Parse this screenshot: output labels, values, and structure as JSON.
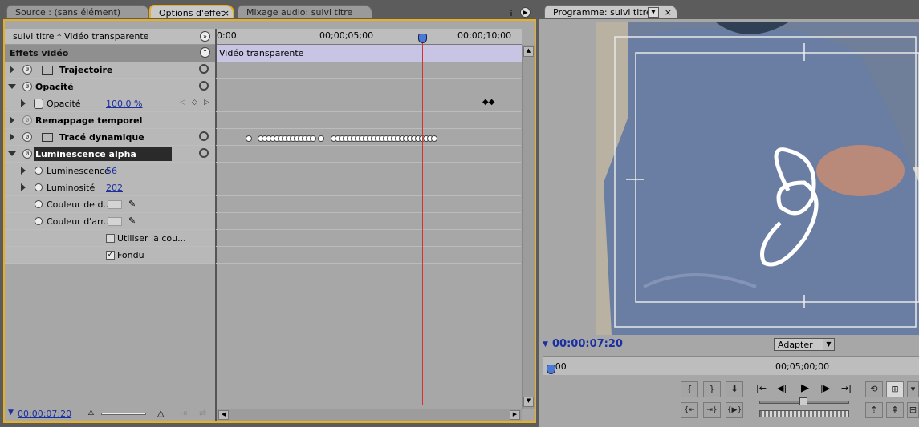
{
  "tabs": {
    "source": "Source : (sans élément)",
    "effect_options": "Options d'effet",
    "audio_mixer": "Mixage audio: suivi titre",
    "program": "Programme: suivi titre"
  },
  "effects_panel": {
    "clip_path": "suivi titre * Vidéo transparente",
    "section_title": "Effets vidéo",
    "clip_bar_label": "Vidéo transparente",
    "ruler": [
      "0:00",
      "00;00;05;00",
      "00;00;10;00"
    ],
    "timecode": "00:00:07:20",
    "rows": {
      "trajectoire": "Trajectoire",
      "opacite": "Opacité",
      "opacite_param": "Opacité",
      "opacite_value": "100,0 %",
      "remappage": "Remappage temporel",
      "trace": "Tracé dynamique",
      "luminescence_alpha": "Luminescence alpha",
      "luminescence": "Luminescence",
      "luminescence_value": "56",
      "luminosite": "Luminosité",
      "luminosite_value": "202",
      "couleur_d": "Couleur de d...",
      "couleur_arr": "Couleur d'arr...",
      "utiliser": "Utiliser la cou...",
      "fondu": "Fondu"
    }
  },
  "program": {
    "timecode": "00:00:07:20",
    "fit_select": "Adapter",
    "ruler": [
      ":00",
      "00;05;00;00"
    ]
  },
  "colors": {
    "accent": "#e8b020",
    "playhead": "#d83030",
    "timecode": "#1a2fa0"
  }
}
